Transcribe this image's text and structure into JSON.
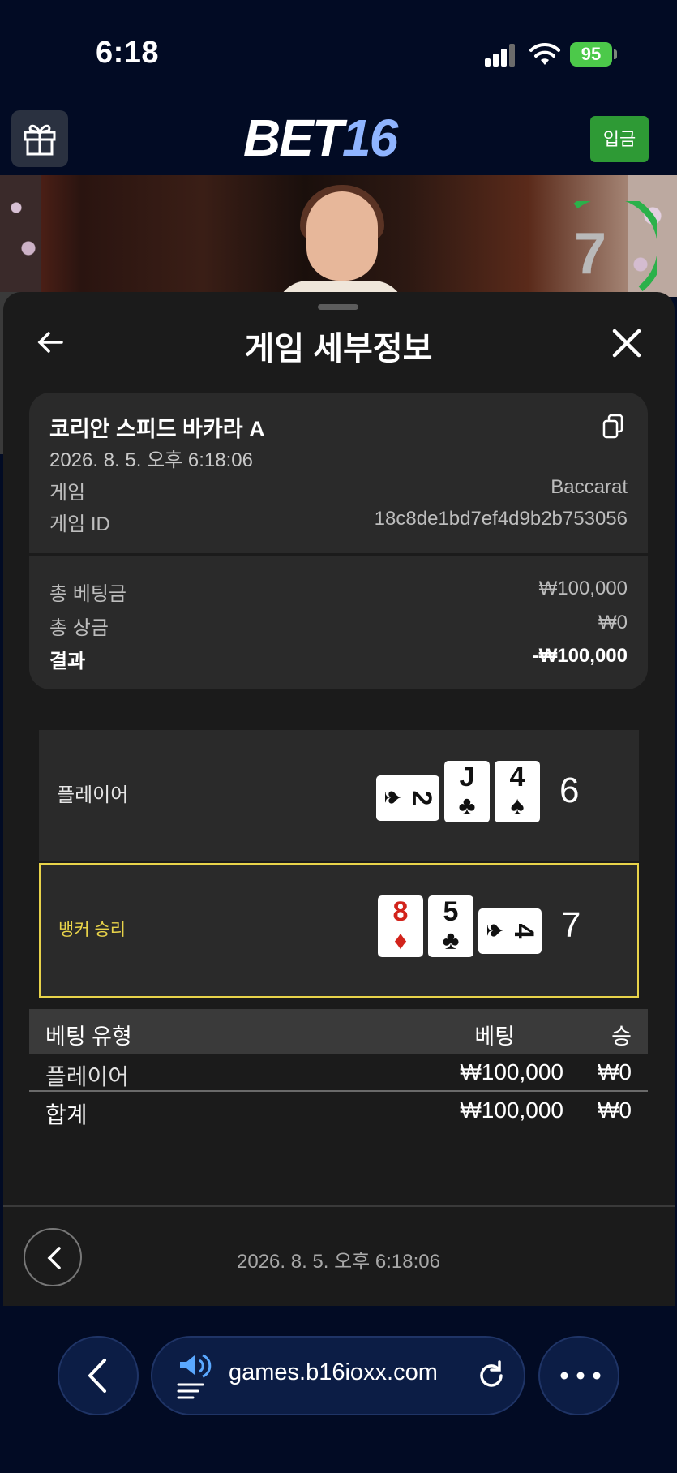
{
  "status_bar": {
    "time": "6:18",
    "battery": "95"
  },
  "header": {
    "logo_main": "BET",
    "logo_num": "16",
    "deposit_label": "입금"
  },
  "video": {
    "timer": "7"
  },
  "sheet": {
    "title": "게임 세부정보",
    "game": {
      "name": "코리안 스피드 바카라 A",
      "datetime": "2026. 8. 5. 오후 6:18:06",
      "type_label": "게임",
      "type_value": "Baccarat",
      "id_label": "게임 ID",
      "id_value": "18c8de1bd7ef4d9b2b753056"
    },
    "summary": {
      "total_bet_label": "총 베팅금",
      "total_bet_value": "₩100,000",
      "total_win_label": "총 상금",
      "total_win_value": "₩0",
      "result_label": "결과",
      "result_value": "-₩100,000"
    },
    "hands": {
      "player": {
        "label": "플레이어",
        "score": "6",
        "cards": [
          {
            "rank": "2",
            "suit": "♠",
            "color": "#111111",
            "rotated": true
          },
          {
            "rank": "J",
            "suit": "♣",
            "color": "#111111",
            "rotated": false
          },
          {
            "rank": "4",
            "suit": "♠",
            "color": "#111111",
            "rotated": false
          }
        ]
      },
      "banker": {
        "label": "뱅커 승리",
        "score": "7",
        "cards": [
          {
            "rank": "8",
            "suit": "♦",
            "color": "#d2231b",
            "rotated": false
          },
          {
            "rank": "5",
            "suit": "♣",
            "color": "#111111",
            "rotated": false
          },
          {
            "rank": "4",
            "suit": "♠",
            "color": "#111111",
            "rotated": true
          }
        ]
      }
    },
    "bets": {
      "headers": {
        "type": "베팅 유형",
        "bet": "베팅",
        "win": "승"
      },
      "rows": [
        {
          "type": "플레이어",
          "bet": "₩100,000",
          "win": "₩0"
        }
      ],
      "total": {
        "type": "합계",
        "bet": "₩100,000",
        "win": "₩0"
      }
    },
    "footer_datetime": "2026. 8. 5. 오후 6:18:06"
  },
  "browser": {
    "url": "games.b16ioxx.com"
  },
  "colors": {
    "accent_green": "#2e9a35",
    "highlight_yellow": "#e8d34a",
    "card_red": "#d2231b"
  }
}
